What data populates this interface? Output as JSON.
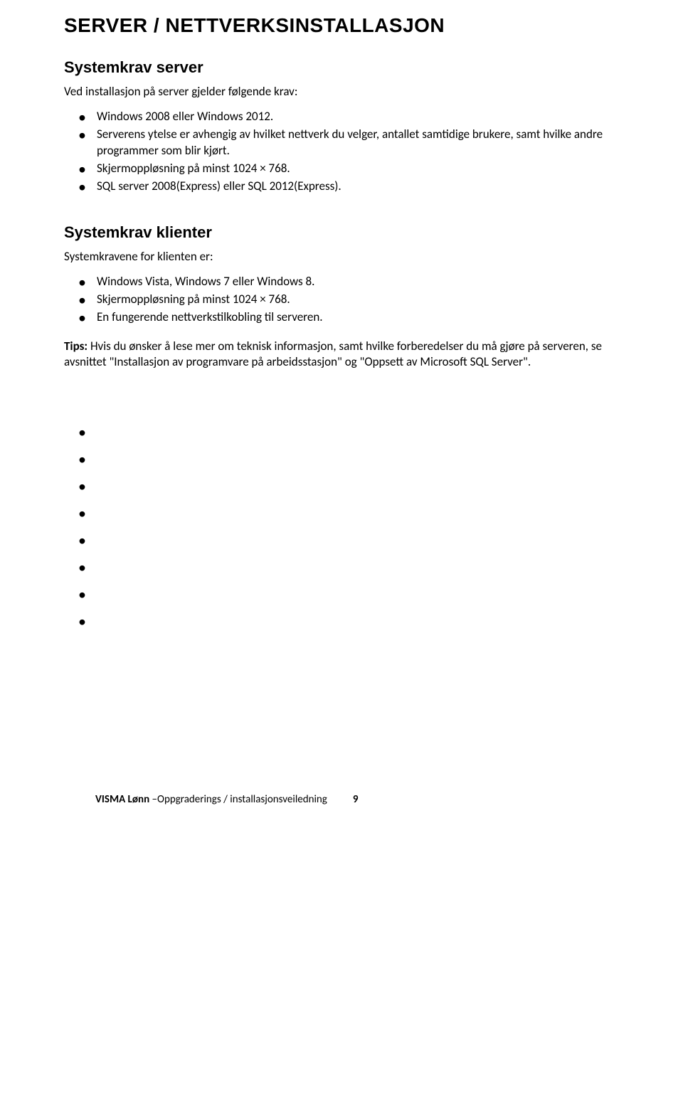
{
  "heading_main": "SERVER / NETTVERKSINSTALLASJON",
  "section_server": {
    "title": "Systemkrav server",
    "intro": "Ved installasjon på server gjelder følgende krav:",
    "bullets": [
      "Windows 2008 eller Windows 2012.",
      "Serverens ytelse er avhengig av hvilket nettverk du velger, antallet samtidige brukere, samt hvilke andre programmer som blir kjørt.",
      "Skjermoppløsning på minst 1024 × 768.",
      "SQL server 2008(Express) eller SQL 2012(Express)."
    ]
  },
  "section_client": {
    "title": "Systemkrav klienter",
    "intro": "Systemkravene for klienten er:",
    "bullets": [
      "Windows Vista, Windows 7 eller Windows 8.",
      "Skjermoppløsning på minst 1024 × 768.",
      "En fungerende nettverkstilkobling til serveren."
    ]
  },
  "tips": {
    "label": "Tips:",
    "text": " Hvis du ønsker å lese mer om teknisk informasjon, samt hvilke forberedelser du må gjøre på serveren, se avsnittet \"Installasjon av programvare på arbeidsstasjon\" og \"Oppsett av Microsoft SQL Server\"."
  },
  "empty_bullet_count": 8,
  "footer": {
    "title_bold": "VISMA Lønn",
    "title_rest": " –Oppgraderings / installasjonsveiledning",
    "page_number": "9"
  }
}
